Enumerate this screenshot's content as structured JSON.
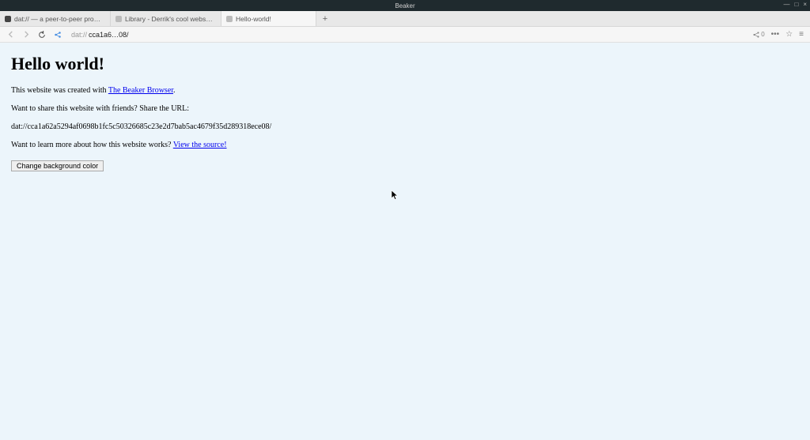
{
  "window": {
    "title": "Beaker",
    "controls": {
      "min": "—",
      "max": "□",
      "close": "×"
    }
  },
  "tabs": {
    "items": [
      {
        "label": "dat:// — a peer-to-peer protocol"
      },
      {
        "label": "Library - Derrik's cool website thing"
      },
      {
        "label": "Hello-world!"
      }
    ],
    "newtab": "+"
  },
  "toolbar": {
    "back": "◄",
    "forward": "►",
    "reload": "⟳",
    "share_glyph": "share",
    "url_prefix": "dat://",
    "url_main": "cca1a6…08/",
    "right": {
      "share_count": "0",
      "more": "•••",
      "star": "☆",
      "menu": "≡"
    }
  },
  "content": {
    "heading": "Hello world!",
    "p1_pre": "This website was created with ",
    "p1_link": "The Beaker Browser",
    "p1_post": ".",
    "p2": "Want to share this website with friends? Share the URL:",
    "dat_url": "dat://cca1a62a5294af0698b1fc5c50326685c23e2d7bab5ac4679f35d289318ece08/",
    "p3_pre": "Want to learn more about how this website works? ",
    "p3_link": "View the source!",
    "button": "Change background color"
  }
}
